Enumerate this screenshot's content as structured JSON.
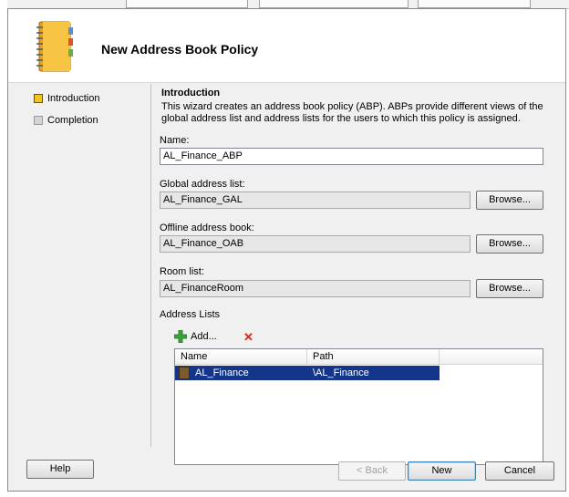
{
  "dialog": {
    "title": "New Address Book Policy",
    "icon": "address-book-icon"
  },
  "nav": {
    "items": [
      {
        "label": "Introduction",
        "active": true
      },
      {
        "label": "Completion",
        "active": false
      }
    ]
  },
  "intro": {
    "heading": "Introduction",
    "description": "This wizard creates an address book policy (ABP). ABPs provide different views of the global address list and address lists for the users to which this policy is assigned."
  },
  "form": {
    "name_label": "Name:",
    "name_value": "AL_Finance_ABP",
    "gal_label": "Global address list:",
    "gal_value": "AL_Finance_GAL",
    "oab_label": "Offline address book:",
    "oab_value": "AL_Finance_OAB",
    "room_label": "Room list:",
    "room_value": "AL_FinanceRoom",
    "browse_label": "Browse..."
  },
  "address_lists": {
    "label": "Address Lists",
    "add_label": "Add...",
    "remove_icon": "red-x-icon",
    "columns": [
      "Name",
      "Path"
    ],
    "rows": [
      {
        "name": "AL_Finance",
        "path": "\\AL_Finance",
        "selected": true
      }
    ]
  },
  "footer": {
    "help": "Help",
    "back": "< Back",
    "next": "New",
    "cancel": "Cancel"
  },
  "colors": {
    "selection": "#14368a",
    "active_step": "#f4c21d",
    "remove": "#d0281c"
  }
}
